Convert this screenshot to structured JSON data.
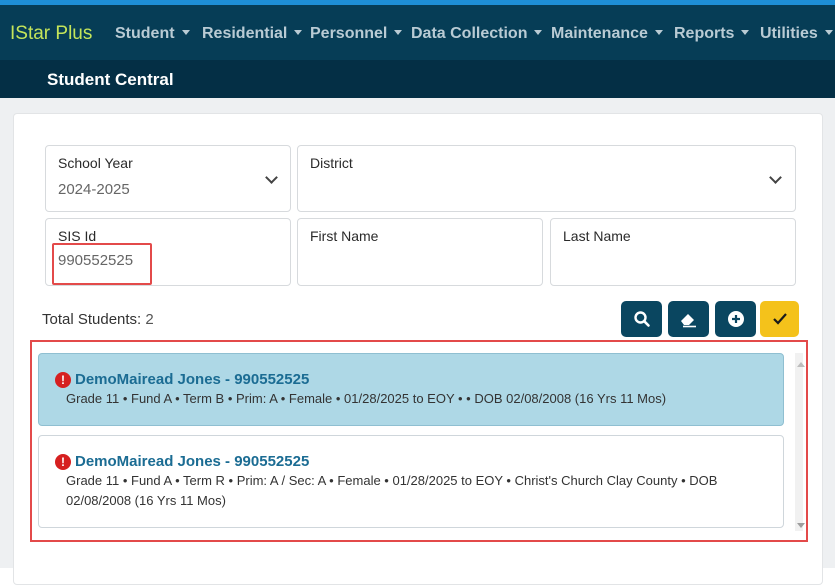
{
  "app": {
    "brand": "IStar Plus"
  },
  "nav": {
    "items": [
      {
        "label": "Student"
      },
      {
        "label": "Residential"
      },
      {
        "label": "Personnel"
      },
      {
        "label": "Data Collection"
      },
      {
        "label": "Maintenance"
      },
      {
        "label": "Reports"
      },
      {
        "label": "Utilities"
      }
    ]
  },
  "page": {
    "title": "Student Central"
  },
  "filters": {
    "school_year": {
      "label": "School Year",
      "value": "2024-2025"
    },
    "district": {
      "label": "District",
      "value": ""
    },
    "sis_id": {
      "label": "SIS Id",
      "value": "990552525"
    },
    "first_name": {
      "label": "First Name",
      "value": ""
    },
    "last_name": {
      "label": "Last Name",
      "value": ""
    }
  },
  "summary": {
    "label": "Total Students:",
    "count": "2"
  },
  "toolbar": {
    "search_icon": "search-icon",
    "clear_icon": "eraser-icon",
    "add_icon": "plus-circle-icon",
    "confirm_icon": "checkmark-icon"
  },
  "students": [
    {
      "name": "DemoMairead Jones - 990552525",
      "details": "Grade 11 • Fund A • Term B • Prim: A • Female • 01/28/2025 to EOY •  • DOB 02/08/2008 (16 Yrs 11 Mos)",
      "selected": true
    },
    {
      "name": "DemoMairead Jones - 990552525",
      "details": "Grade 11 • Fund A • Term R • Prim: A / Sec: A • Female • 01/28/2025 to EOY • Christ's Church Clay County • DOB 02/08/2008 (16 Yrs 11 Mos)",
      "selected": false
    }
  ],
  "colors": {
    "navbar": "#063d56",
    "subbar": "#042f45",
    "brand": "#c4e55a",
    "accent_stripe": "#1e8fd6",
    "selected_card": "#aed8e6",
    "highlight": "#e34a4a",
    "gold_button": "#f4c21b",
    "alert": "#d62020"
  }
}
